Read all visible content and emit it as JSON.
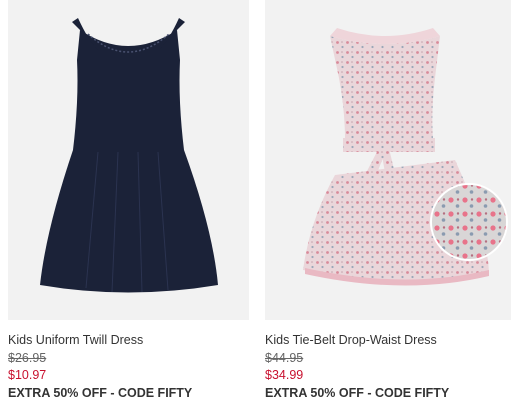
{
  "products": [
    {
      "name": "Kids Uniform Twill Dress",
      "original_price": "$26.95",
      "sale_price": "$10.97",
      "promo": "EXTRA 50% OFF - CODE FIFTY",
      "image_icon": "navy-dress-image"
    },
    {
      "name": "Kids Tie-Belt Drop-Waist Dress",
      "original_price": "$44.95",
      "sale_price": "$34.99",
      "promo": "EXTRA 50% OFF - CODE FIFTY",
      "image_icon": "floral-dress-image"
    }
  ],
  "colors": {
    "sale": "#c8102e",
    "text": "#333333",
    "strike": "#666666",
    "image_bg": "#f2f2f2",
    "navy_dress": "#1b2238",
    "floral_dress": "#e6c9cf"
  }
}
